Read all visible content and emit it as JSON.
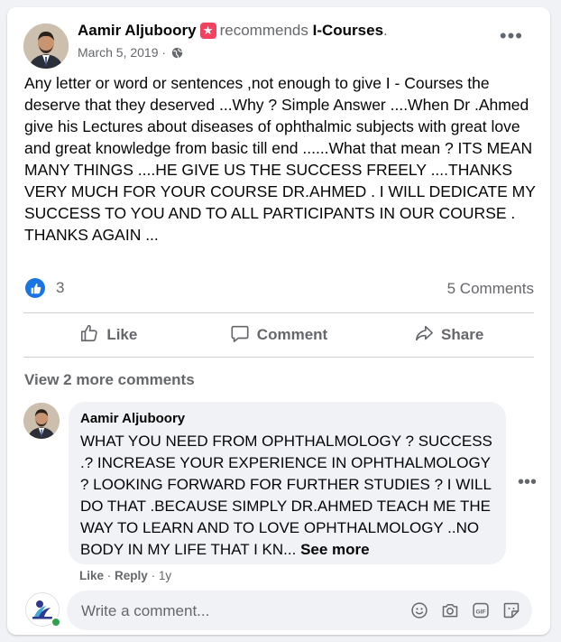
{
  "post": {
    "author": "Aamir Aljuboory",
    "recommends_text": "recommends",
    "page_name": "I-Courses",
    "punct": ".",
    "date": "March 5, 2019",
    "date_sep": "·",
    "text": "Any letter or word or sentences ,not enough to give I - Courses the deserve that they  deserved ...Why ? Simple Answer ....When Dr .Ahmed give his Lectures about diseases of ophthalmic subjects with great  love and   great knowledge  from basic till end ......What that mean ? ITS MEAN MANY THINGS ....HE GIVE US THE SUCCESS FREELY ....THANKS VERY  MUCH FOR YOUR COURSE DR.AHMED . I  WILL DEDICATE MY SUCCESS TO YOU AND TO ALL PARTICIPANTS IN OUR COURSE .\nTHANKS AGAIN ...",
    "reaction_count": "3",
    "comments_count": "5 Comments"
  },
  "actions": {
    "like": "Like",
    "comment": "Comment",
    "share": "Share"
  },
  "view_more": "View 2 more comments",
  "comment": {
    "author": "Aamir Aljuboory",
    "text": "WHAT YOU NEED FROM OPHTHALMOLOGY ? SUCCESS .? INCREASE YOUR EXPERIENCE IN OPHTHALMOLOGY ? LOOKING FORWARD FOR FURTHER STUDIES ? I WILL DO THAT .BECAUSE SIMPLY DR.AHMED TEACH ME THE WAY TO LEARN AND TO LOVE OPHTHALMOLOGY ..NO BODY IN MY LIFE THAT I KN...",
    "see_more": "See more",
    "like": "Like",
    "reply": "Reply",
    "sep": "·",
    "time": "1y"
  },
  "composer": {
    "placeholder": "Write a comment..."
  },
  "icons": {
    "recommend": "star-badge-icon",
    "privacy": "globe-icon",
    "reaction": "like-reaction-icon",
    "composer": [
      "emoji-icon",
      "camera-icon",
      "gif-icon",
      "sticker-icon"
    ]
  },
  "colors": {
    "accent": "#1b74e4",
    "recommend_badge": "#f3425f",
    "online": "#31a24c"
  }
}
